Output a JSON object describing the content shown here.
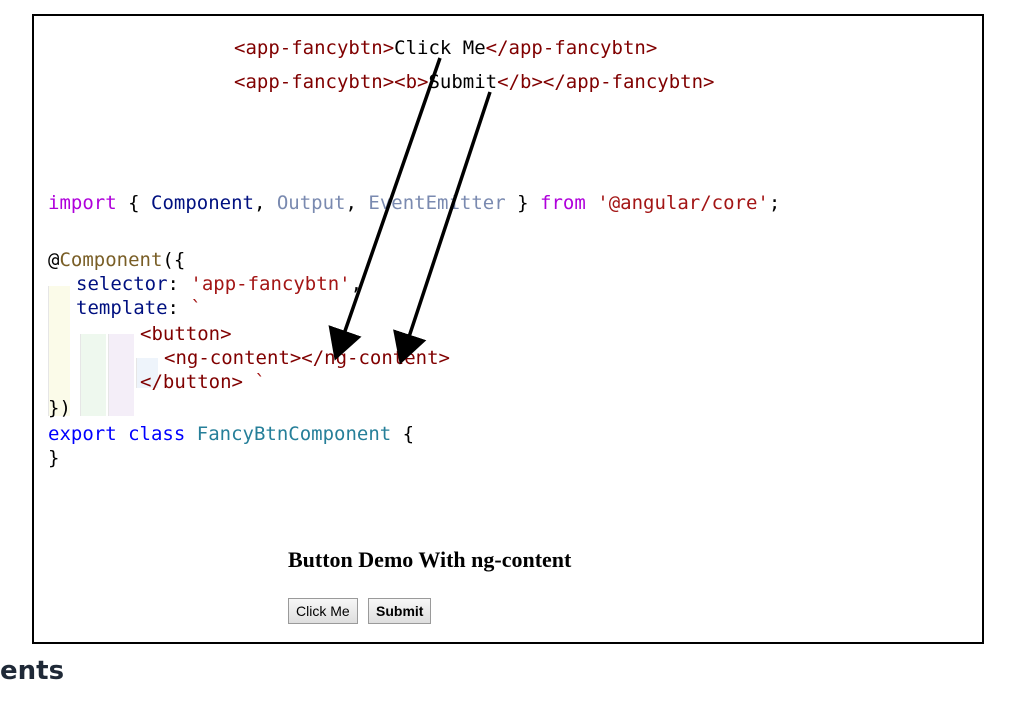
{
  "usage": {
    "line1": {
      "open": "<app-fancybtn>",
      "text": "Click Me",
      "close": "</app-fancybtn>"
    },
    "line2": {
      "open": "<app-fancybtn>",
      "b_open": "<b>",
      "text": "Submit",
      "b_close": "</b>",
      "close": "</app-fancybtn>"
    }
  },
  "code": {
    "import_kw": "import",
    "brace_open": "{",
    "component": "Component",
    "comma1": ",",
    "output": "Output",
    "comma2": ",",
    "event_emitter": "EventEmitter",
    "brace_close": "}",
    "from_kw": "from",
    "module": "'@angular/core'",
    "semicolon": ";",
    "decorator_at": "@",
    "decorator_name": "Component",
    "decorator_open": "({",
    "selector_key": "selector",
    "selector_colon": ":",
    "selector_value": "'app-fancybtn'",
    "selector_comma": ",",
    "template_key": "template",
    "template_colon": ":",
    "template_tick": "`",
    "button_open": "<button>",
    "ng_content": "<ng-content></ng-content>",
    "button_close": "</button>",
    "button_close_tick": "`",
    "decorator_close": "})",
    "export_kw": "export",
    "class_kw": "class",
    "class_name": "FancyBtnComponent",
    "class_brace_open": "{",
    "class_brace_close": "}"
  },
  "demo": {
    "title": "Button Demo With ng-content",
    "buttons": [
      "Click Me",
      "Submit"
    ]
  },
  "footer": {
    "text": "ents"
  },
  "colors": {
    "frame_border": "#000000",
    "tag": "#800000",
    "keyword_blue": "#0000ff",
    "keyword_purple": "#af00db",
    "string": "#a31515",
    "type": "#267f99",
    "arrow": "#000000"
  }
}
